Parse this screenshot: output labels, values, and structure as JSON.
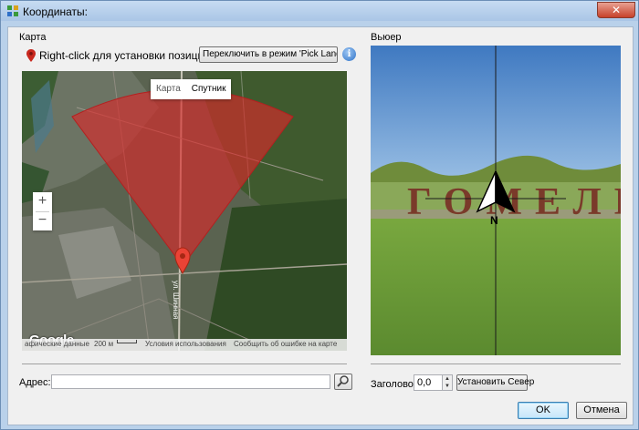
{
  "window": {
    "title": "Координаты:",
    "close_label": "✕"
  },
  "map_panel": {
    "group_label": "Карта",
    "hint": "Right-click для установки позиции!",
    "pick_landmark_label": "Переключить в режим 'Pick Landmark'",
    "info_label": "i",
    "map_type": {
      "map_label": "Карта",
      "satellite_label": "Спутник",
      "selected": "Спутник"
    },
    "zoom": {
      "in_label": "+",
      "out_label": "−"
    },
    "google_logo": "Google",
    "street_label": "ул. Шинная",
    "footer": {
      "data_label": "афические данные",
      "scale_label": "200 м",
      "terms_label": "Условия использования",
      "report_label": "Сообщить об ошибке на карте"
    },
    "address_label": "Адрес:",
    "address_value": ""
  },
  "viewer_panel": {
    "group_label": "Вьюер",
    "compass_label": "N",
    "sign_text": "ГОМЕЛЬ",
    "heading_label": "Заголовок:",
    "heading_value": "0,0",
    "set_north_label": "Установить Север"
  },
  "dialog": {
    "ok_label": "OK",
    "cancel_label": "Отмена"
  },
  "colors": {
    "fov_fill": "#d92a2a",
    "sky": "#4f86c6",
    "grass": "#5b8a2f",
    "accent": "#3c7fb1"
  }
}
